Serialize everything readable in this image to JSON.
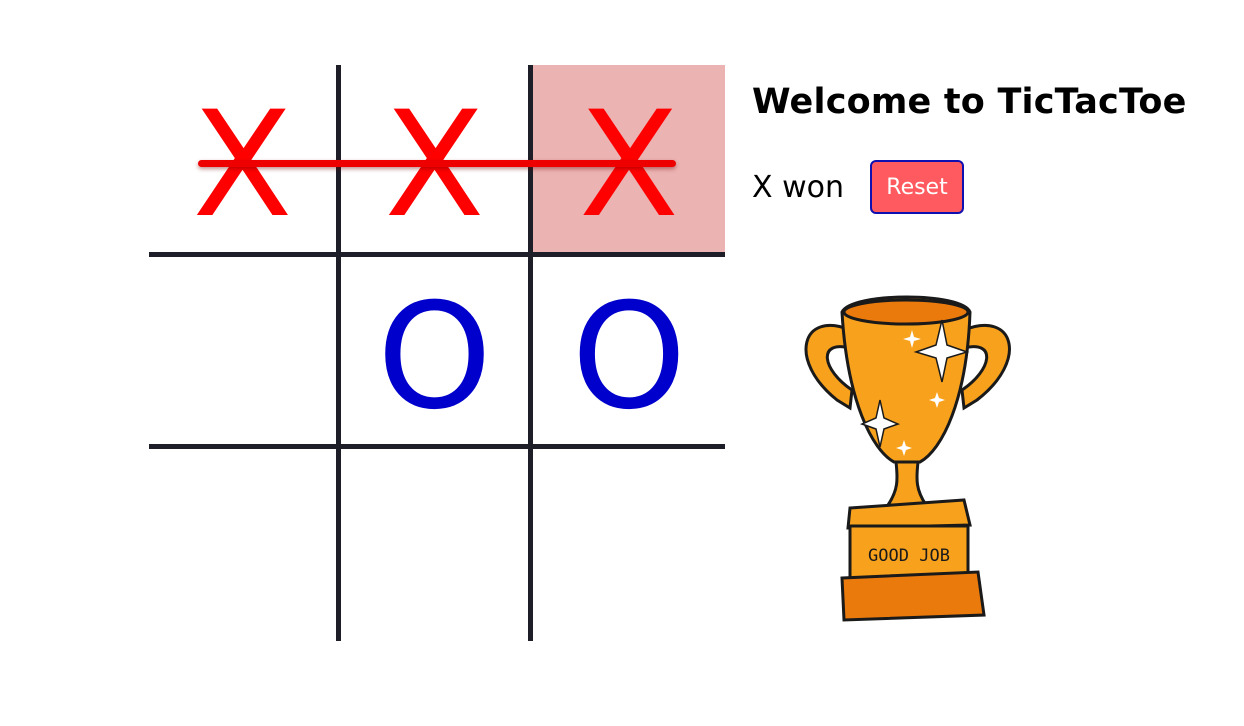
{
  "header": {
    "title": "Welcome to TicTacToe"
  },
  "status": {
    "text": "X won",
    "reset_label": "Reset"
  },
  "board": {
    "cells": [
      "X",
      "X",
      "X",
      "",
      "O",
      "O",
      "",
      "",
      ""
    ],
    "winning_cells": [
      0,
      1,
      2
    ],
    "winner": "X"
  },
  "trophy": {
    "plaque_text": "GOOD JOB"
  },
  "colors": {
    "x": "#ff0000",
    "o": "#0000cc",
    "grid": "#1e1e28",
    "highlight": "#ecb3b3",
    "reset_bg": "#ff5a5f",
    "reset_border": "#1010b0",
    "trophy": "#f7a11c"
  }
}
